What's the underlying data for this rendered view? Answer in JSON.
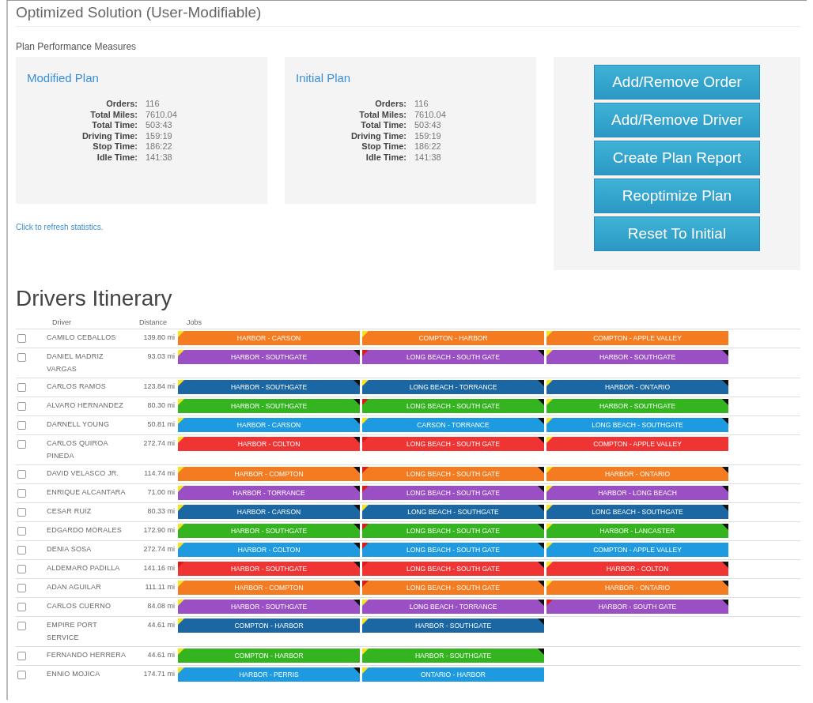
{
  "title": "Optimized Solution (User-Modifiable)",
  "measures_heading": "Plan Performance Measures",
  "plans": [
    {
      "title": "Modified Plan",
      "stats": [
        {
          "label": "Orders:",
          "value": "116"
        },
        {
          "label": "Total Miles:",
          "value": "7610.04"
        },
        {
          "label": "Total Time:",
          "value": "503:43"
        },
        {
          "label": "Driving Time:",
          "value": "159:19"
        },
        {
          "label": "Stop Time:",
          "value": "186:22"
        },
        {
          "label": "Idle Time:",
          "value": "141:38"
        }
      ]
    },
    {
      "title": "Initial Plan",
      "stats": [
        {
          "label": "Orders:",
          "value": "116"
        },
        {
          "label": "Total Miles:",
          "value": "7610.04"
        },
        {
          "label": "Total Time:",
          "value": "503:43"
        },
        {
          "label": "Driving Time:",
          "value": "159:19"
        },
        {
          "label": "Stop Time:",
          "value": "186:22"
        },
        {
          "label": "Idle Time:",
          "value": "141:38"
        }
      ]
    }
  ],
  "actions": [
    "Add/Remove Order",
    "Add/Remove Driver",
    "Create Plan Report",
    "Reoptimize Plan",
    "Reset To Initial"
  ],
  "refresh_link": "Click to refresh statistics.",
  "itinerary": {
    "title": "Drivers Itinerary",
    "columns": [
      "Driver",
      "Distance",
      "Jobs"
    ],
    "rows": [
      {
        "checked": false,
        "driver": "CAMILO CEBALLOS",
        "distance": "139.80 mi",
        "color": "#f47b20",
        "jobs": [
          {
            "label": "HARBOR - CARSON",
            "late": false,
            "end_marked": false
          },
          {
            "label": "COMPTON - HARBOR",
            "late": false,
            "end_marked": false
          },
          {
            "label": "COMPTON - APPLE VALLEY",
            "late": false,
            "end_marked": false
          }
        ]
      },
      {
        "checked": false,
        "driver": "DANIEL MADRIZ VARGAS",
        "distance": "93.03 mi",
        "color": "#9b4fc4",
        "jobs": [
          {
            "label": "HARBOR - SOUTHGATE",
            "late": false,
            "end_marked": true
          },
          {
            "label": "LONG BEACH - SOUTH GATE",
            "late": true,
            "end_marked": true
          },
          {
            "label": "HARBOR - SOUTHGATE",
            "late": false,
            "end_marked": true
          }
        ]
      },
      {
        "checked": false,
        "driver": "CARLOS RAMOS",
        "distance": "123.84 mi",
        "color": "#1a67a3",
        "jobs": [
          {
            "label": "HARBOR - SOUTHGATE",
            "late": false,
            "end_marked": true
          },
          {
            "label": "LONG BEACH - TORRANCE",
            "late": false,
            "end_marked": true
          },
          {
            "label": "HARBOR - ONTARIO",
            "late": false,
            "end_marked": true
          }
        ]
      },
      {
        "checked": false,
        "driver": "ALVARO HERNANDEZ",
        "distance": "80.30 mi",
        "color": "#34b51f",
        "jobs": [
          {
            "label": "HARBOR - SOUTHGATE",
            "late": false,
            "end_marked": true
          },
          {
            "label": "LONG BEACH - SOUTH GATE",
            "late": true,
            "end_marked": true
          },
          {
            "label": "HARBOR - SOUTHGATE",
            "late": false,
            "end_marked": true
          }
        ]
      },
      {
        "checked": false,
        "driver": "DARNELL YOUNG",
        "distance": "50.81 mi",
        "color": "#1e9be0",
        "jobs": [
          {
            "label": "HARBOR - CARSON",
            "late": false,
            "end_marked": true
          },
          {
            "label": "CARSON - TORRANCE",
            "late": false,
            "end_marked": true
          },
          {
            "label": "LONG BEACH - SOUTHGATE",
            "late": false,
            "end_marked": true
          }
        ]
      },
      {
        "checked": false,
        "driver": "CARLOS QUIROA PINEDA",
        "distance": "272.74 mi",
        "color": "#f03333",
        "jobs": [
          {
            "label": "HARBOR - COLTON",
            "late": false,
            "end_marked": true
          },
          {
            "label": "LONG BEACH - SOUTH GATE",
            "late": true,
            "end_marked": true
          },
          {
            "label": "COMPTON - APPLE VALLEY",
            "late": false,
            "end_marked": false
          }
        ]
      },
      {
        "checked": false,
        "driver": "DAVID VELASCO JR.",
        "distance": "114.74 mi",
        "color": "#f47b20",
        "jobs": [
          {
            "label": "HARBOR - COMPTON",
            "late": false,
            "end_marked": true
          },
          {
            "label": "LONG BEACH - SOUTH GATE",
            "late": true,
            "end_marked": true
          },
          {
            "label": "HARBOR - ONTARIO",
            "late": false,
            "end_marked": true
          }
        ]
      },
      {
        "checked": false,
        "driver": "ENRIQUE ALCANTARA",
        "distance": "71.00 mi",
        "color": "#9b4fc4",
        "jobs": [
          {
            "label": "HARBOR - TORRANCE",
            "late": false,
            "end_marked": true
          },
          {
            "label": "LONG BEACH - SOUTH GATE",
            "late": true,
            "end_marked": true
          },
          {
            "label": "HARBOR - LONG BEACH",
            "late": false,
            "end_marked": true
          }
        ]
      },
      {
        "checked": false,
        "driver": "CESAR RUIZ",
        "distance": "80.33 mi",
        "color": "#1a67a3",
        "jobs": [
          {
            "label": "HARBOR - CARSON",
            "late": false,
            "end_marked": true
          },
          {
            "label": "LONG BEACH - SOUTHGATE",
            "late": false,
            "end_marked": true
          },
          {
            "label": "LONG BEACH - SOUTHGATE",
            "late": false,
            "end_marked": true
          }
        ]
      },
      {
        "checked": false,
        "driver": "EDGARDO MORALES",
        "distance": "172.90 mi",
        "color": "#34b51f",
        "jobs": [
          {
            "label": "HARBOR - SOUTHGATE",
            "late": false,
            "end_marked": true
          },
          {
            "label": "LONG BEACH - SOUTH GATE",
            "late": true,
            "end_marked": true
          },
          {
            "label": "HARBOR - LANCASTER",
            "late": false,
            "end_marked": true
          }
        ]
      },
      {
        "checked": false,
        "driver": "DENIA SOSA",
        "distance": "272.74 mi",
        "color": "#1e9be0",
        "jobs": [
          {
            "label": "HARBOR - COLTON",
            "late": false,
            "end_marked": true
          },
          {
            "label": "LONG BEACH - SOUTH GATE",
            "late": true,
            "end_marked": true
          },
          {
            "label": "COMPTON - APPLE VALLEY",
            "late": false,
            "end_marked": false
          }
        ]
      },
      {
        "checked": false,
        "driver": "ALDEMARO PADILLA",
        "distance": "141.16 mi",
        "color": "#f03333",
        "jobs": [
          {
            "label": "HARBOR - SOUTHGATE",
            "late": true,
            "end_marked": true
          },
          {
            "label": "LONG BEACH - SOUTH GATE",
            "late": true,
            "end_marked": true
          },
          {
            "label": "HARBOR - COLTON",
            "late": false,
            "end_marked": true
          }
        ]
      },
      {
        "checked": false,
        "driver": "ADAN AGUILAR",
        "distance": "111.11 mi",
        "color": "#f47b20",
        "jobs": [
          {
            "label": "HARBOR - COMPTON",
            "late": false,
            "end_marked": true
          },
          {
            "label": "LONG BEACH - SOUTH GATE",
            "late": true,
            "end_marked": true
          },
          {
            "label": "HARBOR - ONTARIO",
            "late": false,
            "end_marked": true
          }
        ]
      },
      {
        "checked": false,
        "driver": "CARLOS CUERNO",
        "distance": "84.08 mi",
        "color": "#9b4fc4",
        "jobs": [
          {
            "label": "HARBOR - SOUTHGATE",
            "late": false,
            "end_marked": true
          },
          {
            "label": "LONG BEACH - TORRANCE",
            "late": false,
            "end_marked": true
          },
          {
            "label": "HARBOR - SOUTH GATE",
            "late": true,
            "end_marked": true
          }
        ]
      },
      {
        "checked": false,
        "driver": "EMPIRE PORT SERVICE",
        "distance": "44.61 mi",
        "color": "#1a67a3",
        "jobs": [
          {
            "label": "COMPTON - HARBOR",
            "late": false,
            "end_marked": false
          },
          {
            "label": "HARBOR - SOUTHGATE",
            "late": false,
            "end_marked": true
          }
        ]
      },
      {
        "checked": false,
        "driver": "FERNANDO HERRERA",
        "distance": "44.61 mi",
        "color": "#34b51f",
        "jobs": [
          {
            "label": "COMPTON - HARBOR",
            "late": false,
            "end_marked": false
          },
          {
            "label": "HARBOR - SOUTHGATE",
            "late": false,
            "end_marked": true
          }
        ]
      },
      {
        "checked": false,
        "driver": "ENNIO MOJICA",
        "distance": "174.71 mi",
        "color": "#1e9be0",
        "jobs": [
          {
            "label": "HARBOR - PERRIS",
            "late": false,
            "end_marked": true
          },
          {
            "label": "ONTARIO - HARBOR",
            "late": false,
            "end_marked": false
          }
        ]
      }
    ]
  }
}
